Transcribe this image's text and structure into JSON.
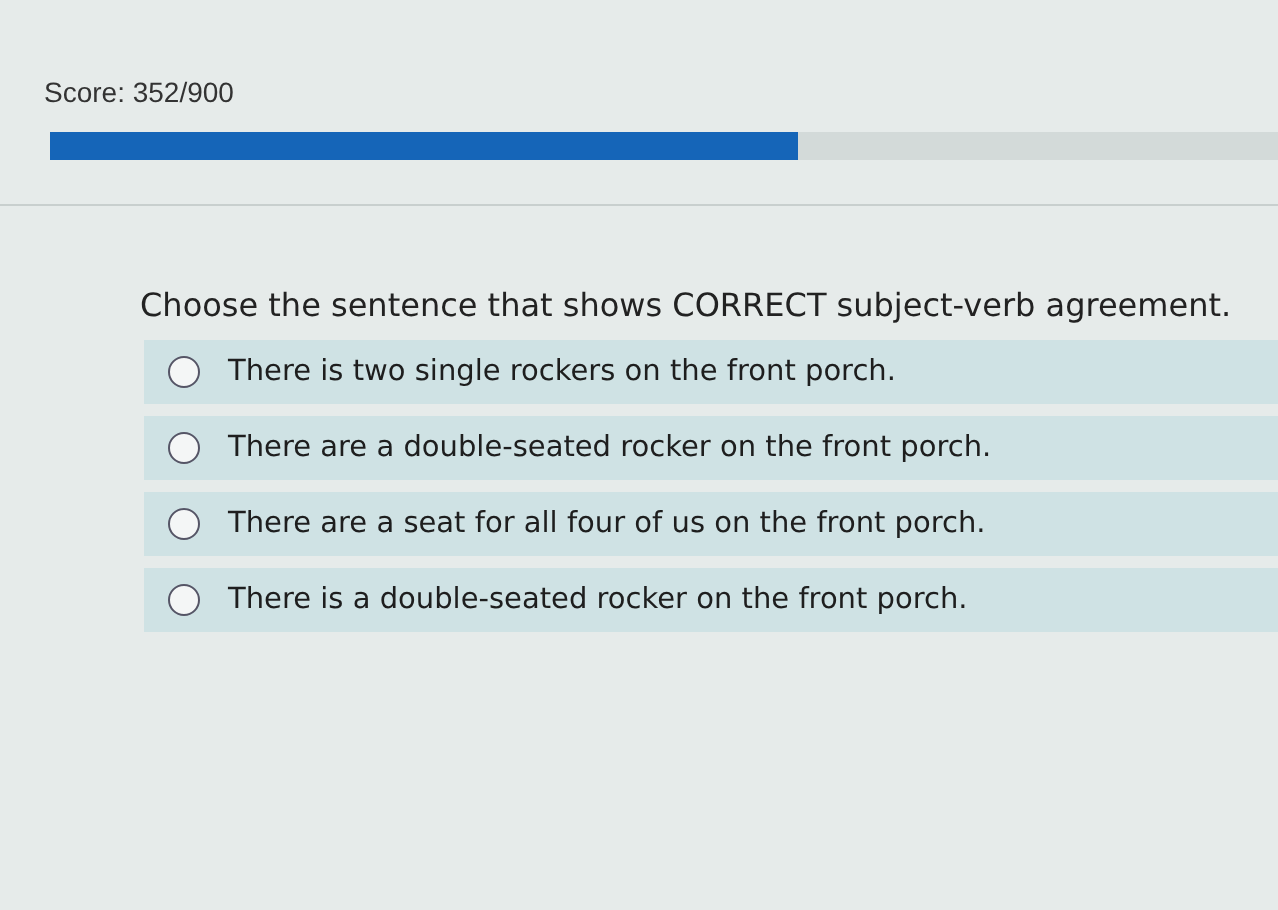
{
  "score": "Score: 352/900",
  "progress": {
    "level": 0.59
  },
  "question": "Choose the sentence that shows CORRECT subject-verb agreement.",
  "options": [
    {
      "label": "There is two single rockers on the front porch.",
      "selected": false
    },
    {
      "label": "There are a double-seated rocker on the front porch.",
      "selected": false
    },
    {
      "label": "There are a seat for all four of us on the front porch.",
      "selected": false
    },
    {
      "label": "There is a double-seated rocker on the front porch.",
      "selected": false
    }
  ]
}
